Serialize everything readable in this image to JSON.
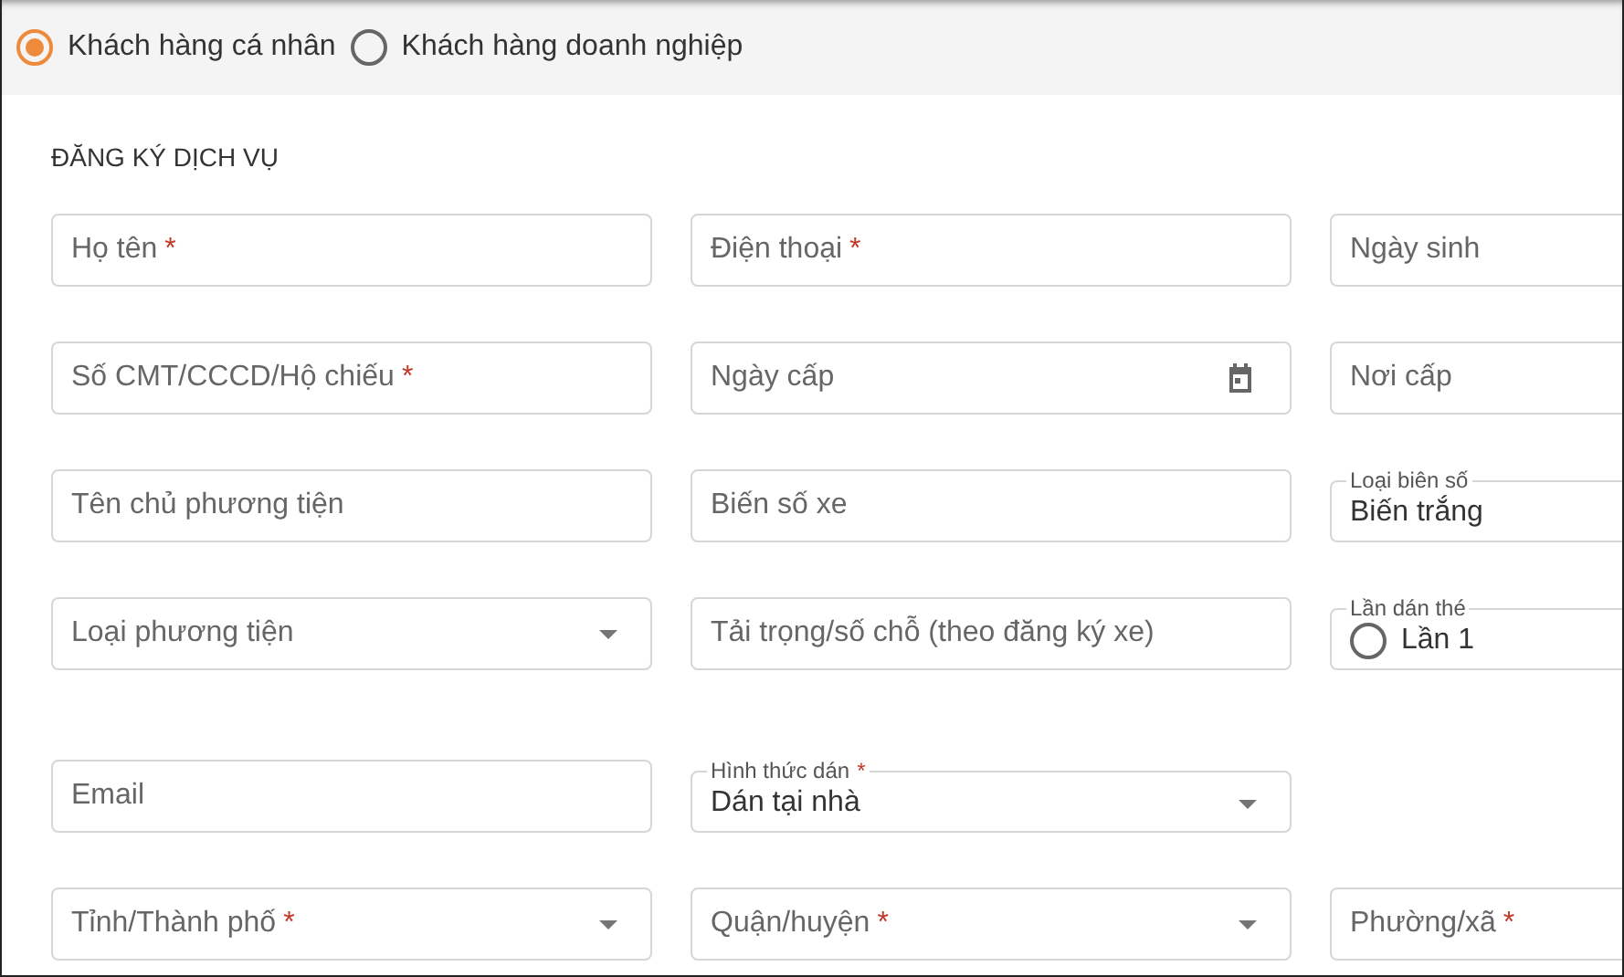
{
  "customer_types": [
    {
      "label": "Khách hàng cá nhân",
      "selected": true
    },
    {
      "label": "Khách hàng doanh nghiệp",
      "selected": false
    }
  ],
  "form": {
    "title": "ĐĂNG KÝ DỊCH VỤ",
    "rows": [
      [
        {
          "kind": "text",
          "placeholder": "Họ tên",
          "required_mark": "*"
        },
        {
          "kind": "text",
          "placeholder": "Điện thoại",
          "required_mark": "*"
        },
        {
          "kind": "text",
          "placeholder": "Ngày sinh"
        }
      ],
      [
        {
          "kind": "text",
          "placeholder": "Số CMT/CCCD/Hộ chiếu",
          "required_mark": "*"
        },
        {
          "kind": "date",
          "placeholder": "Ngày cấp"
        },
        {
          "kind": "text",
          "placeholder": "Nơi cấp"
        }
      ],
      [
        {
          "kind": "text",
          "placeholder": "Tên chủ phương tiện"
        },
        {
          "kind": "text",
          "placeholder": "Biến số xe"
        },
        {
          "kind": "filled",
          "label": "Loại biên số",
          "value": "Biến trắng"
        }
      ],
      [
        {
          "kind": "select",
          "placeholder": "Loại phương tiện"
        },
        {
          "kind": "text",
          "placeholder": "Tải trọng/số chỗ (theo đăng ký xe)"
        },
        {
          "kind": "radio",
          "label": "Lần dán thé",
          "options": [
            {
              "label": "Lần 1",
              "selected": false
            }
          ]
        }
      ],
      [
        {
          "kind": "text",
          "placeholder": "Email"
        },
        {
          "kind": "select-filled",
          "label": "Hình thức dán",
          "required_mark": "*",
          "value": "Dán tại nhà"
        }
      ],
      [
        {
          "kind": "select",
          "placeholder": "Tỉnh/Thành phố",
          "required_mark": "*"
        },
        {
          "kind": "select",
          "placeholder": "Quận/huyện",
          "required_mark": "*"
        },
        {
          "kind": "text",
          "placeholder": "Phường/xã",
          "required_mark": "*"
        }
      ]
    ]
  }
}
